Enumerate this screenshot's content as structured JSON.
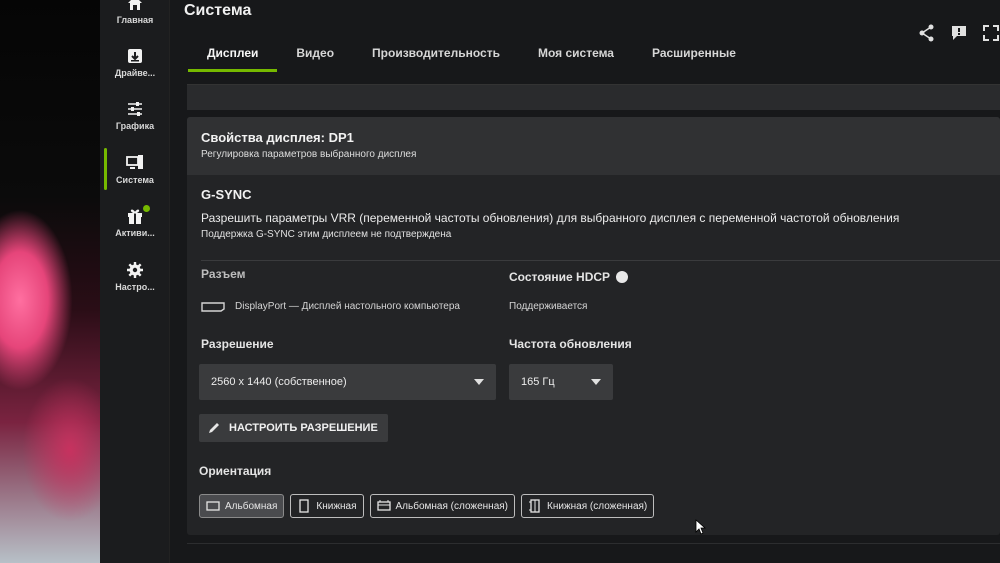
{
  "sidebar": {
    "items": [
      {
        "label": "Главная",
        "icon": "home-icon"
      },
      {
        "label": "Драйве...",
        "icon": "download-icon"
      },
      {
        "label": "Графика",
        "icon": "sliders-icon"
      },
      {
        "label": "Система",
        "icon": "monitor-icon"
      },
      {
        "label": "Активи...",
        "icon": "gift-icon"
      },
      {
        "label": "Настро...",
        "icon": "gear-icon"
      }
    ]
  },
  "header": {
    "title": "Система"
  },
  "tabs": [
    {
      "label": "Дисплеи",
      "active": true
    },
    {
      "label": "Видео",
      "active": false
    },
    {
      "label": "Производительность",
      "active": false
    },
    {
      "label": "Моя система",
      "active": false
    },
    {
      "label": "Расширенные",
      "active": false
    }
  ],
  "display": {
    "title": "Свойства дисплея: DP1",
    "subtitle": "Регулировка параметров выбранного дисплея",
    "gsync_title": "G-SYNC",
    "gsync_desc": "Разрешить параметры VRR (переменной частоты обновления) для выбранного дисплея с переменной частотой обновления",
    "gsync_note": "Поддержка G-SYNC этим дисплеем не подтверждена",
    "connector_label": "Разъем",
    "connector_value": "DisplayPort — Дисплей настольного компьютера",
    "hdcp_label": "Состояние HDCP",
    "hdcp_value": "Поддерживается",
    "resolution_label": "Разрешение",
    "resolution_value": "2560 x 1440 (собственное)",
    "refresh_label": "Частота обновления",
    "refresh_value": "165 Гц",
    "customize_button": "НАСТРОИТЬ РАЗРЕШЕНИЕ",
    "orientation_label": "Ориентация",
    "orientations": [
      {
        "label": "Альбомная",
        "active": true
      },
      {
        "label": "Книжная",
        "active": false
      },
      {
        "label": "Альбомная (сложенная)",
        "active": false
      },
      {
        "label": "Книжная (сложенная)",
        "active": false
      }
    ]
  },
  "colors": {
    "accent": "#76b900",
    "background": "#17181a",
    "panel": "#232426"
  }
}
